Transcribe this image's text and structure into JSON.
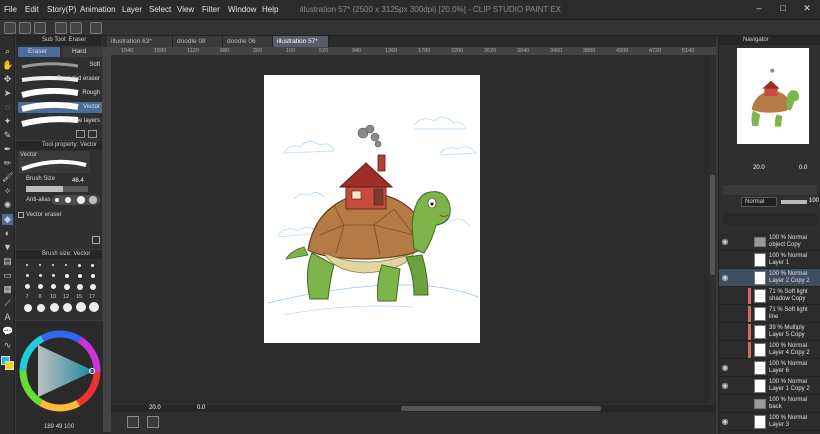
{
  "menubar": {
    "items": [
      "File",
      "Edit",
      "Story(P)",
      "Animation",
      "Layer",
      "Select",
      "View",
      "Filter",
      "Window",
      "Help"
    ],
    "title": "illustration 57* (2500 x 3125px 300dpi) [20.0%] - CLIP STUDIO PAINT EX"
  },
  "subtool": {
    "header": "Sub Tool: Eraser",
    "tabs": [
      "Eraser",
      "Hard"
    ],
    "items": [
      "Soft",
      "Rounded eraser",
      "Rough",
      "Vector",
      "Some layers"
    ]
  },
  "toolprop": {
    "header": "Tool property: Vector",
    "preview_label": "Vector",
    "brush_size_label": "Brush Size",
    "brush_size_value": "46.4",
    "antialias_label": "Anti-alias",
    "vector_eraser_label": "Vector eraser"
  },
  "brushsize": {
    "header": "Brush size: Vector",
    "labels": [
      "7",
      "8",
      "10",
      "12",
      "15",
      "17"
    ]
  },
  "colorbar": {
    "readout": [
      "189",
      "49",
      "100"
    ]
  },
  "doctabs": [
    "illustration 63*",
    "doodle 08",
    "doodle 06",
    "illustration 57*"
  ],
  "ruler": [
    "1540",
    "1580",
    "1120",
    "680",
    "260",
    "100",
    "520",
    "940",
    "1360",
    "1780",
    "2200",
    "2620",
    "3040",
    "3460",
    "3880",
    "4300",
    "4720",
    "5140"
  ],
  "statusbar": {
    "zoom": "20.0",
    "rotation": "0.0"
  },
  "navigator": {
    "header": "Navigator",
    "zoom": "20.0",
    "angle": "0.0"
  },
  "layerprops": {
    "blend_mode": "Normal",
    "opacity": "100"
  },
  "layers": [
    {
      "opacity_mode": "100 % Normal",
      "name": "object Copy",
      "visible": true,
      "folder": true,
      "clip": false,
      "selected": false
    },
    {
      "opacity_mode": "100 % Normal",
      "name": "Layer 1",
      "visible": false,
      "folder": false,
      "clip": false,
      "selected": false
    },
    {
      "opacity_mode": "100 % Normal",
      "name": "Layer 2 Copy 2",
      "visible": true,
      "folder": false,
      "clip": false,
      "selected": true
    },
    {
      "opacity_mode": "71 % Soft light",
      "name": "shadow Copy",
      "visible": false,
      "folder": false,
      "clip": true,
      "selected": false
    },
    {
      "opacity_mode": "71 % Soft light",
      "name": "line",
      "visible": false,
      "folder": false,
      "clip": true,
      "selected": false
    },
    {
      "opacity_mode": "39 % Multiply",
      "name": "Layer 5 Copy",
      "visible": false,
      "folder": false,
      "clip": true,
      "selected": false
    },
    {
      "opacity_mode": "100 % Normal",
      "name": "Layer 4 Copy 2",
      "visible": false,
      "folder": false,
      "clip": true,
      "selected": false
    },
    {
      "opacity_mode": "100 % Normal",
      "name": "Layer 6",
      "visible": true,
      "folder": false,
      "clip": false,
      "selected": false
    },
    {
      "opacity_mode": "100 % Normal",
      "name": "Layer 1 Copy 2",
      "visible": true,
      "folder": false,
      "clip": false,
      "selected": false
    },
    {
      "opacity_mode": "100 % Normal",
      "name": "back",
      "visible": false,
      "folder": true,
      "clip": false,
      "selected": false
    },
    {
      "opacity_mode": "100 % Normal",
      "name": "Layer 3",
      "visible": true,
      "folder": false,
      "clip": false,
      "selected": false
    }
  ],
  "colors": {
    "accent": "#4a6d9a",
    "selected_layer": "#3f4d61",
    "clip_marker": "#d46a6a",
    "canvas_bg": "#2b2b2b"
  }
}
